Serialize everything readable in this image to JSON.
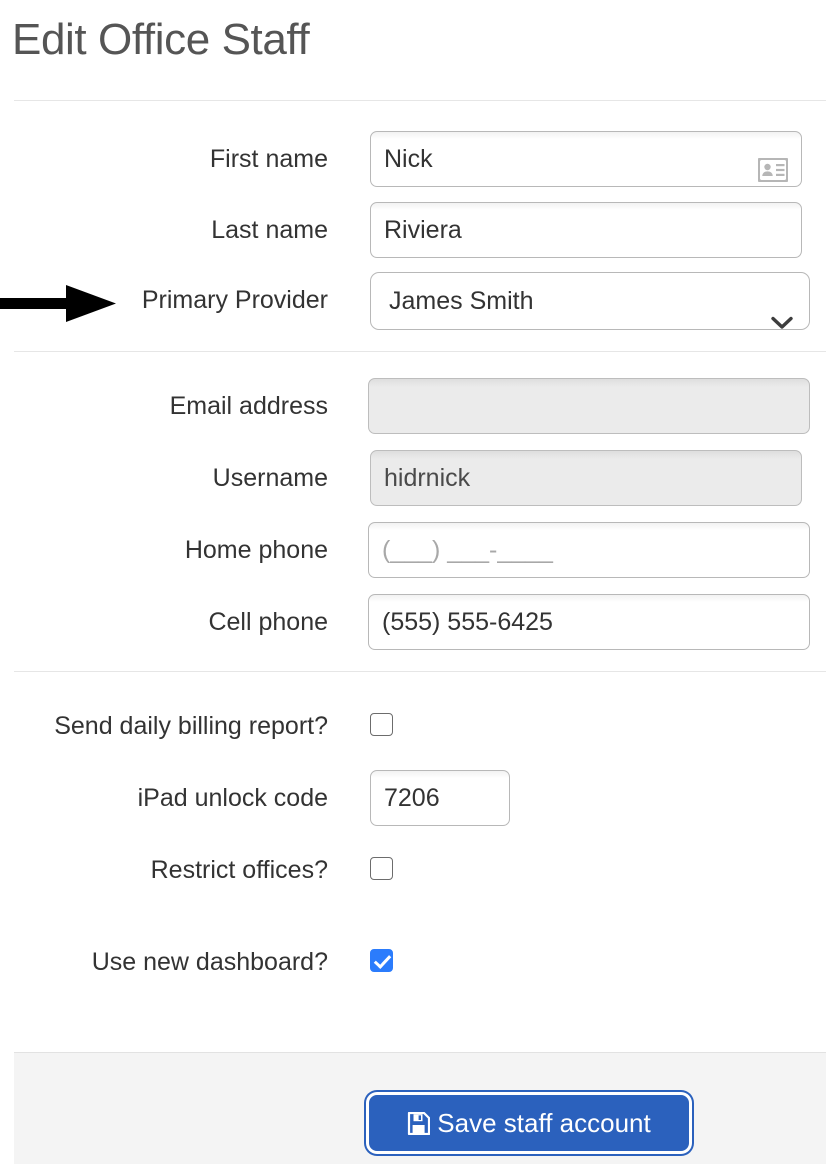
{
  "page": {
    "title": "Edit Office Staff"
  },
  "identity_section": {
    "fields": [
      {
        "label": "First name",
        "value": "Nick",
        "type": "text",
        "icon": "contact-card-icon",
        "disabled": false
      },
      {
        "label": "Last name",
        "value": "Riviera",
        "type": "text",
        "disabled": false
      },
      {
        "label": "Primary Provider",
        "value": "James Smith",
        "type": "select",
        "icon": "chevron-down-icon",
        "disabled": false
      }
    ]
  },
  "contact_section": {
    "fields": [
      {
        "label": "Email address",
        "value": "",
        "placeholder": "",
        "type": "text",
        "disabled": true
      },
      {
        "label": "Username",
        "value": "hidrnick",
        "type": "text",
        "disabled": true
      },
      {
        "label": "Home phone",
        "value": "",
        "placeholder": "(___) ___-____",
        "type": "text",
        "disabled": false
      },
      {
        "label": "Cell phone",
        "value": "(555) 555-6425",
        "type": "text",
        "disabled": false
      }
    ]
  },
  "options_section": {
    "fields": [
      {
        "label": "Send daily billing report?",
        "type": "checkbox",
        "checked": false
      },
      {
        "label": "iPad unlock code",
        "type": "text",
        "value": "7206"
      },
      {
        "label": "Restrict offices?",
        "type": "checkbox",
        "checked": false
      },
      {
        "label": "Use new dashboard?",
        "type": "checkbox",
        "checked": true
      }
    ]
  },
  "footer": {
    "save_label": "Save staff account",
    "save_icon": "floppy-disk-save-icon"
  },
  "annotation": {
    "arrow_target": "Primary Provider",
    "arrow_color": "#000000"
  },
  "colors": {
    "accent_blue": "#2b61bd",
    "checkbox_blue": "#2b7cfc",
    "title_gray": "#555555",
    "footer_gray": "#f4f4f4"
  }
}
